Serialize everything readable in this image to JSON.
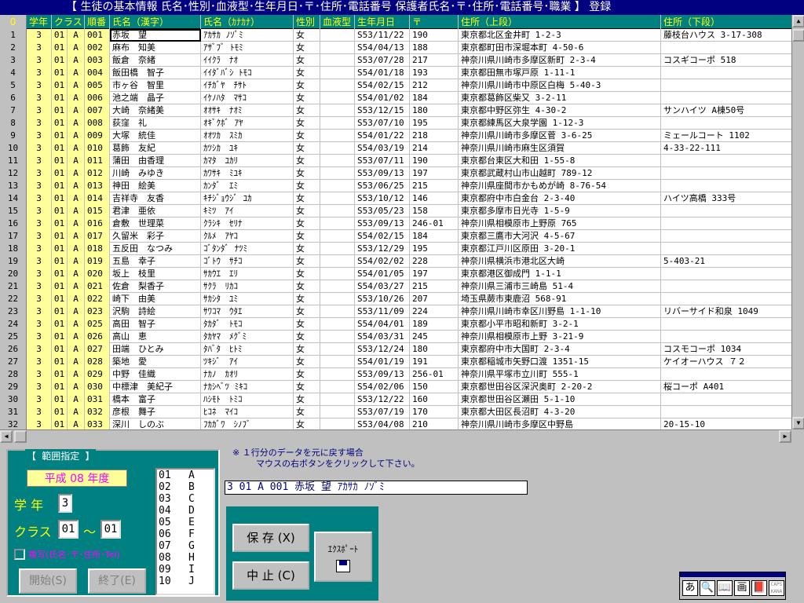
{
  "title": "【 生徒の基本情報 氏名･性別･血液型･生年月日･〒･住所･電話番号 保護者氏名･〒･住所･電話番号･職業 】 登録",
  "columns": [
    "0",
    "学年",
    "クラス",
    "順番",
    "氏名（漢字）",
    "氏名（ｶﾅｶﾅ）",
    "性別",
    "血液型",
    "生年月日",
    "〒",
    "住所（上段）",
    "住所（下段）"
  ],
  "rows": [
    [
      "1",
      "3",
      "01",
      "A",
      "001",
      "赤坂　望",
      "ｱｶｻｶ ﾉｿﾞﾐ",
      "女",
      "",
      "S53/11/22",
      "190",
      "東京都北区金井町 1-2-3",
      "藤枝台ハウス 3-17-308"
    ],
    [
      "2",
      "3",
      "01",
      "A",
      "002",
      "麻布　知美",
      "ｱｻﾞﾌﾞ ﾄﾓﾐ",
      "女",
      "",
      "S54/04/13",
      "188",
      "東京都町田市深堀本町 4-50-6",
      ""
    ],
    [
      "3",
      "3",
      "01",
      "A",
      "003",
      "飯倉　奈緒",
      "ｲｲｸﾗ　ﾅｵ",
      "女",
      "",
      "S53/07/28",
      "217",
      "神奈川県川崎市多摩区新町 2-3-4",
      "コスギコーポ 518"
    ],
    [
      "4",
      "3",
      "01",
      "A",
      "004",
      "飯田橋　智子",
      "ｲｲﾀﾞﾊﾞｼ ﾄﾓｺ",
      "女",
      "",
      "S54/01/18",
      "193",
      "東京都田無市塚戸原 1-11-1",
      ""
    ],
    [
      "5",
      "3",
      "01",
      "A",
      "005",
      "市ヶ谷　智里",
      "ｲﾁｶﾞﾔ　ﾁｻﾄ",
      "女",
      "",
      "S54/02/15",
      "212",
      "神奈川県川崎市中原区白梅 5-40-3",
      ""
    ],
    [
      "6",
      "3",
      "01",
      "A",
      "006",
      "池之端　晶子",
      "ｲｹﾉﾊﾀ　ﾏｻｺ",
      "女",
      "",
      "S54/01/02",
      "184",
      "東京都葛飾区柴又 3-2-11",
      ""
    ],
    [
      "7",
      "3",
      "01",
      "A",
      "007",
      "大崎　奈緒美",
      "ｵｵｻｷ　ﾅｵﾐ",
      "女",
      "",
      "S53/12/15",
      "180",
      "東京都中野区弥生 4-30-2",
      "サンハイツ A棟50号"
    ],
    [
      "8",
      "3",
      "01",
      "A",
      "008",
      "荻窪　礼",
      "ｵｷﾞｸﾎﾞ ｱﾔ",
      "女",
      "",
      "S53/07/10",
      "195",
      "東京都練馬区大泉学園 1-12-3",
      ""
    ],
    [
      "9",
      "3",
      "01",
      "A",
      "009",
      "大塚　統佳",
      "ｵｵﾂｶ　ｽﾐｶ",
      "女",
      "",
      "S54/01/22",
      "218",
      "神奈川県川崎市多摩区菅 3-6-25",
      "ミェールコート 1102"
    ],
    [
      "10",
      "3",
      "01",
      "A",
      "010",
      "葛飾　友紀",
      "ｶﾂｼｶ　ﾕｷ",
      "女",
      "",
      "S54/03/19",
      "214",
      "神奈川県川崎市麻生区須賀",
      "4-33-22-111"
    ],
    [
      "11",
      "3",
      "01",
      "A",
      "011",
      "蒲田　由香理",
      "ｶﾏﾀ　ﾕｶﾘ",
      "女",
      "",
      "S53/07/11",
      "190",
      "東京都台東区大和田 1-55-8",
      ""
    ],
    [
      "12",
      "3",
      "01",
      "A",
      "012",
      "川崎　みゆき",
      "ｶﾜｻｷ　ﾐﾕｷ",
      "女",
      "",
      "S53/09/13",
      "197",
      "東京都武蔵村山市山越町 789-12",
      ""
    ],
    [
      "13",
      "3",
      "01",
      "A",
      "013",
      "神田　絵美",
      "ｶﾝﾀﾞ　ｴﾐ",
      "女",
      "",
      "S53/06/25",
      "215",
      "神奈川県座間市かもめが崎 8-76-54",
      ""
    ],
    [
      "14",
      "3",
      "01",
      "A",
      "014",
      "吉祥寺　友香",
      "ｷﾁｼﾞｮｳｼﾞ ﾕｶ",
      "女",
      "",
      "S53/10/12",
      "146",
      "東京都府中市白金台 2-3-40",
      "ハイツ高橋 333号"
    ],
    [
      "15",
      "3",
      "01",
      "A",
      "015",
      "君津　亜依",
      "ｷﾐﾂ　ｱｲ",
      "女",
      "",
      "S53/05/23",
      "158",
      "東京都多摩市日光寺 1-5-9",
      ""
    ],
    [
      "16",
      "3",
      "01",
      "A",
      "016",
      "倉敷　世理菜",
      "ｸﾗｼｷ　ｾﾘﾅ",
      "女",
      "",
      "S53/09/13",
      "246-01",
      "神奈川県相模原市上野原 765",
      ""
    ],
    [
      "17",
      "3",
      "01",
      "A",
      "017",
      "久留米　彩子",
      "ｸﾙﾒ　ｱﾔｺ",
      "女",
      "",
      "S54/02/15",
      "184",
      "東京都三鷹市大河沢 4-5-67",
      ""
    ],
    [
      "18",
      "3",
      "01",
      "A",
      "018",
      "五反田　なつみ",
      "ｺﾞﾀﾝﾀﾞ ﾅﾂﾐ",
      "女",
      "",
      "S53/12/29",
      "195",
      "東京都江戸川区原田 3-20-1",
      ""
    ],
    [
      "19",
      "3",
      "01",
      "A",
      "019",
      "五島　幸子",
      "ｺﾞﾄｳ　ｻﾁｺ",
      "女",
      "",
      "S54/02/02",
      "228",
      "神奈川県横浜市港北区大崎",
      "5-403-21"
    ],
    [
      "20",
      "3",
      "01",
      "A",
      "020",
      "坂上　枝里",
      "ｻｶｳｴ　ｴﾘ",
      "女",
      "",
      "S54/01/05",
      "197",
      "東京都港区御成門 1-1-1",
      ""
    ],
    [
      "21",
      "3",
      "01",
      "A",
      "021",
      "佐倉　梨香子",
      "ｻｸﾗ　ﾘｶｺ",
      "女",
      "",
      "S54/03/27",
      "215",
      "神奈川県三浦市三崎島 51-4",
      ""
    ],
    [
      "22",
      "3",
      "01",
      "A",
      "022",
      "崎下　由美",
      "ｻｶｼﾀ　ﾕﾐ",
      "女",
      "",
      "S53/10/26",
      "207",
      "埼玉県蕨市東鹿沼 568-91",
      ""
    ],
    [
      "23",
      "3",
      "01",
      "A",
      "023",
      "沢駒　詩絵",
      "ｻﾜｺﾏ　ｳﾀｴ",
      "女",
      "",
      "S53/11/09",
      "224",
      "神奈川県川崎市幸区川野島 1-1-10",
      "リバーサイド和泉 1049"
    ],
    [
      "24",
      "3",
      "01",
      "A",
      "025",
      "高田　智子",
      "ﾀｶﾀﾞ　ﾄﾓｺ",
      "女",
      "",
      "S54/04/01",
      "189",
      "東京都小平市昭和新町 3-2-1",
      ""
    ],
    [
      "25",
      "3",
      "01",
      "A",
      "026",
      "高山　恵",
      "ﾀｶﾔﾏ　ﾒｸﾞﾐ",
      "女",
      "",
      "S54/03/31",
      "245",
      "神奈川県相模原市上野 3-21-9",
      ""
    ],
    [
      "26",
      "3",
      "01",
      "A",
      "027",
      "田端　ひとみ",
      "ﾀﾊﾞﾀ　ﾋﾄﾐ",
      "女",
      "",
      "S53/12/24",
      "180",
      "東京都府中市大国町 2-3-4",
      "コスモコーポ 1034"
    ],
    [
      "27",
      "3",
      "01",
      "A",
      "028",
      "築地　愛",
      "ﾂｷｼﾞ　ｱｲ",
      "女",
      "",
      "S54/01/19",
      "191",
      "東京都稲城市矢野口渡 1351-15",
      "ケイオーハウス ７２"
    ],
    [
      "28",
      "3",
      "01",
      "A",
      "029",
      "中野　佳織",
      "ﾅｶﾉ　ｶｵﾘ",
      "女",
      "",
      "S53/09/13",
      "256-01",
      "神奈川県平塚市立川町 555-1",
      ""
    ],
    [
      "29",
      "3",
      "01",
      "A",
      "030",
      "中標津　美紀子",
      "ﾅｶｼﾍﾞﾂ ﾐｷｺ",
      "女",
      "",
      "S54/02/06",
      "150",
      "東京都世田谷区深沢奥町 2-20-2",
      "桜コーポ A401"
    ],
    [
      "30",
      "3",
      "01",
      "A",
      "031",
      "橋本　富子",
      "ﾊｼﾓﾄ　ﾄﾐｺ",
      "女",
      "",
      "S53/12/22",
      "160",
      "東京都世田谷区瀬田 5-1-10",
      ""
    ],
    [
      "31",
      "3",
      "01",
      "A",
      "032",
      "彦根　舞子",
      "ﾋｺﾈ　ﾏｲｺ",
      "女",
      "",
      "S53/07/19",
      "170",
      "東京都大田区長沼町 4-3-20",
      ""
    ],
    [
      "32",
      "3",
      "01",
      "A",
      "033",
      "深川　しのぶ",
      "ﾌｶｶﾞﾜ　ｼﾉﾌﾞ",
      "女",
      "",
      "S53/04/08",
      "210",
      "神奈川県川崎市多摩区中野島",
      "20-15-10"
    ]
  ],
  "panel": {
    "title": "【 範囲指定 】",
    "year": "平成 08 年度",
    "grade_label": "学 年",
    "grade_value": "3",
    "class_label": "クラス",
    "class_from": "01",
    "tilde": "～",
    "class_to": "01",
    "copy_label": "複写(氏名･〒･住所･Tel)",
    "start_button": "開始(S)",
    "end_button": "終了(E)"
  },
  "class_list": [
    [
      "01",
      "A"
    ],
    [
      "02",
      "B"
    ],
    [
      "03",
      "C"
    ],
    [
      "04",
      "D"
    ],
    [
      "05",
      "E"
    ],
    [
      "06",
      "F"
    ],
    [
      "07",
      "G"
    ],
    [
      "08",
      "H"
    ],
    [
      "09",
      "I"
    ],
    [
      "10",
      "J"
    ]
  ],
  "note_line1": "※ １行分のデータを元に戻す場合",
  "note_line2": "マウスの右ボタンをクリックして下さい。",
  "current_record": "3 01 A 001 赤坂 望 ｱｶｻｶ ﾉｿﾞﾐ",
  "buttons": {
    "save": "保 存 (X)",
    "cancel": "中 止 (C)",
    "export": "ｴｸｽﾎﾟｰﾄ"
  },
  "ime": {
    "icons": [
      "あ",
      "🔍",
      "📖",
      "画",
      "📕"
    ],
    "caps": "CAPS KANA"
  }
}
